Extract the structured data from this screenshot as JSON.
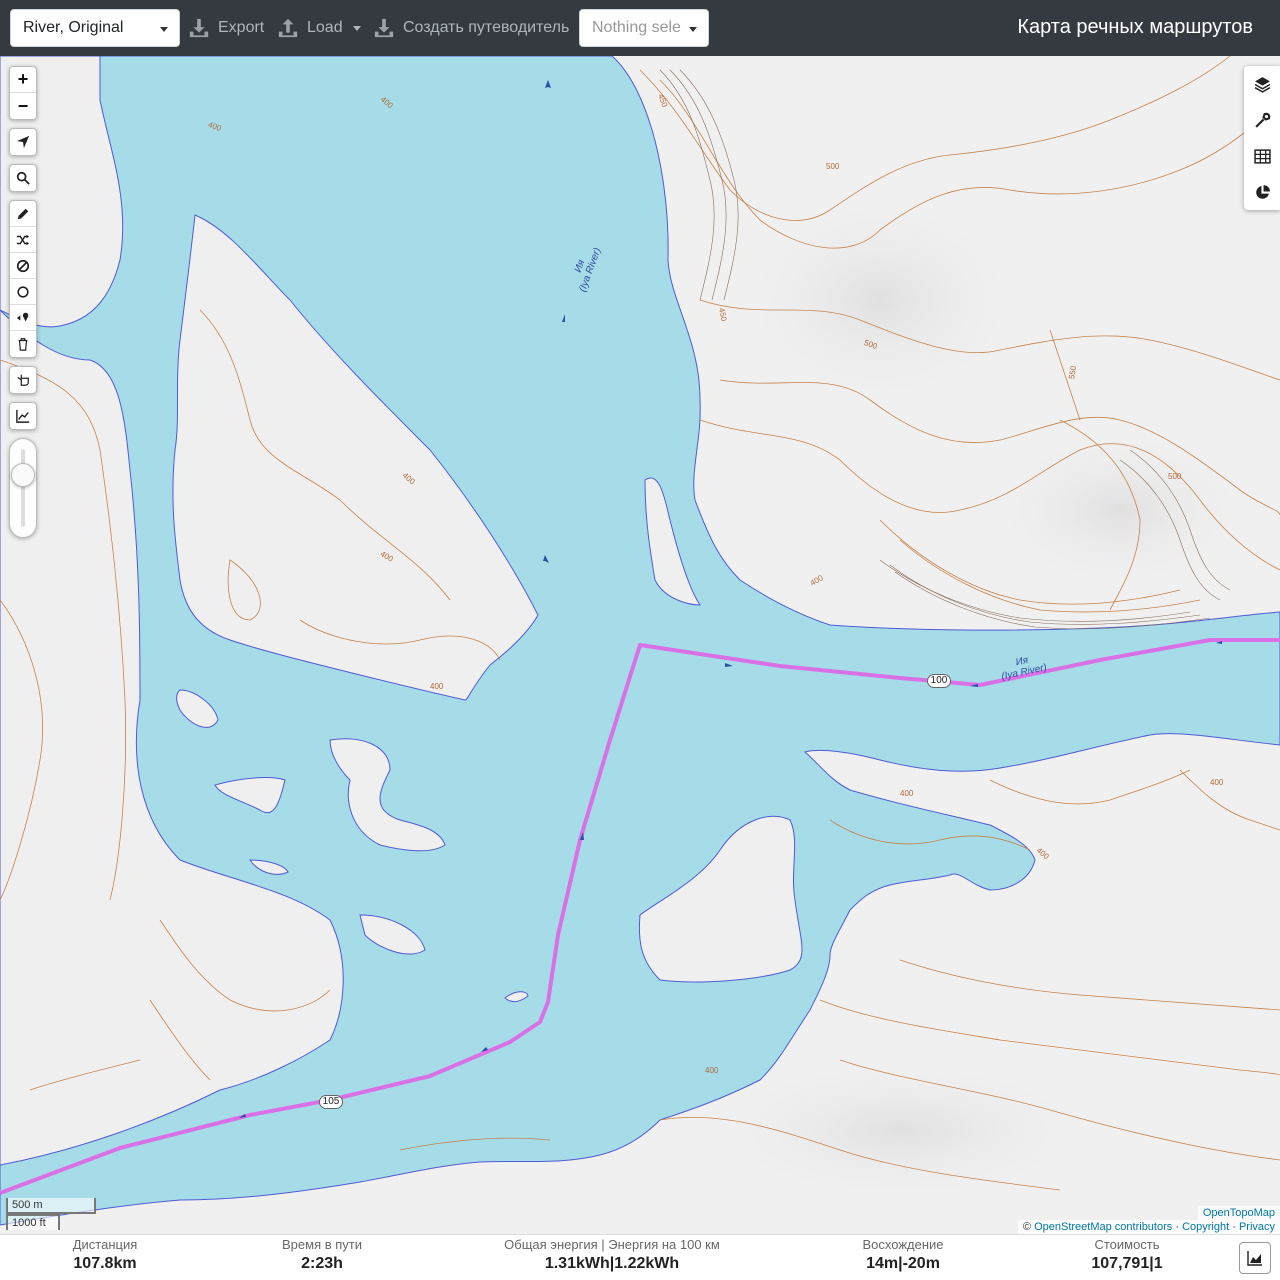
{
  "navbar": {
    "profile_select": "River, Original",
    "export_label": "Export",
    "load_label": "Load",
    "guide_label": "Создать путеводитель",
    "nothing_selected": "Nothing sele",
    "brand": "Карта речных маршрутов"
  },
  "map": {
    "river_label_1": "Ия",
    "river_label_1_en": "(Iya River)",
    "river_label_2": "Ия",
    "river_label_2_en": "(Iya River)",
    "route_badge_1": "100",
    "route_badge_2": "105",
    "contour_400": "400",
    "contour_450": "450",
    "contour_500": "500",
    "contour_550": "550",
    "route_color": "#da70e6",
    "water_color": "#a5dce8",
    "contour_color": "#c8824a"
  },
  "scale": {
    "metric": "500 m",
    "imperial": "1000 ft"
  },
  "attribution": {
    "opentopomap": "OpenTopoMap",
    "copyright_sign": "©",
    "osm": "OpenStreetMap contributors",
    "sep1": "·",
    "copyright": "Copyright",
    "sep2": "·",
    "privacy": "Privacy"
  },
  "left_controls": {
    "zoom_in": "+",
    "zoom_out": "−"
  },
  "stats": {
    "distance_label": "Дистанция",
    "distance_value": "107.8",
    "distance_unit": "km",
    "time_label": "Время в пути",
    "time_value": "2:23",
    "time_unit": "h",
    "energy_label": "Общая энергия | Энергия на 100 км",
    "energy_value_1": "1.31",
    "energy_unit_1": "kWh",
    "energy_sep": "|",
    "energy_value_2": "1.22",
    "energy_unit_2": "kWh",
    "ascent_label": "Восхождение",
    "ascent_value": "14",
    "ascent_unit": "m",
    "ascent_sep": "|",
    "descent_value": "-20",
    "descent_unit": "m",
    "cost_label": "Стоимость",
    "cost_value": "107,791",
    "cost_sep": "|",
    "cost_value_2": "1"
  }
}
